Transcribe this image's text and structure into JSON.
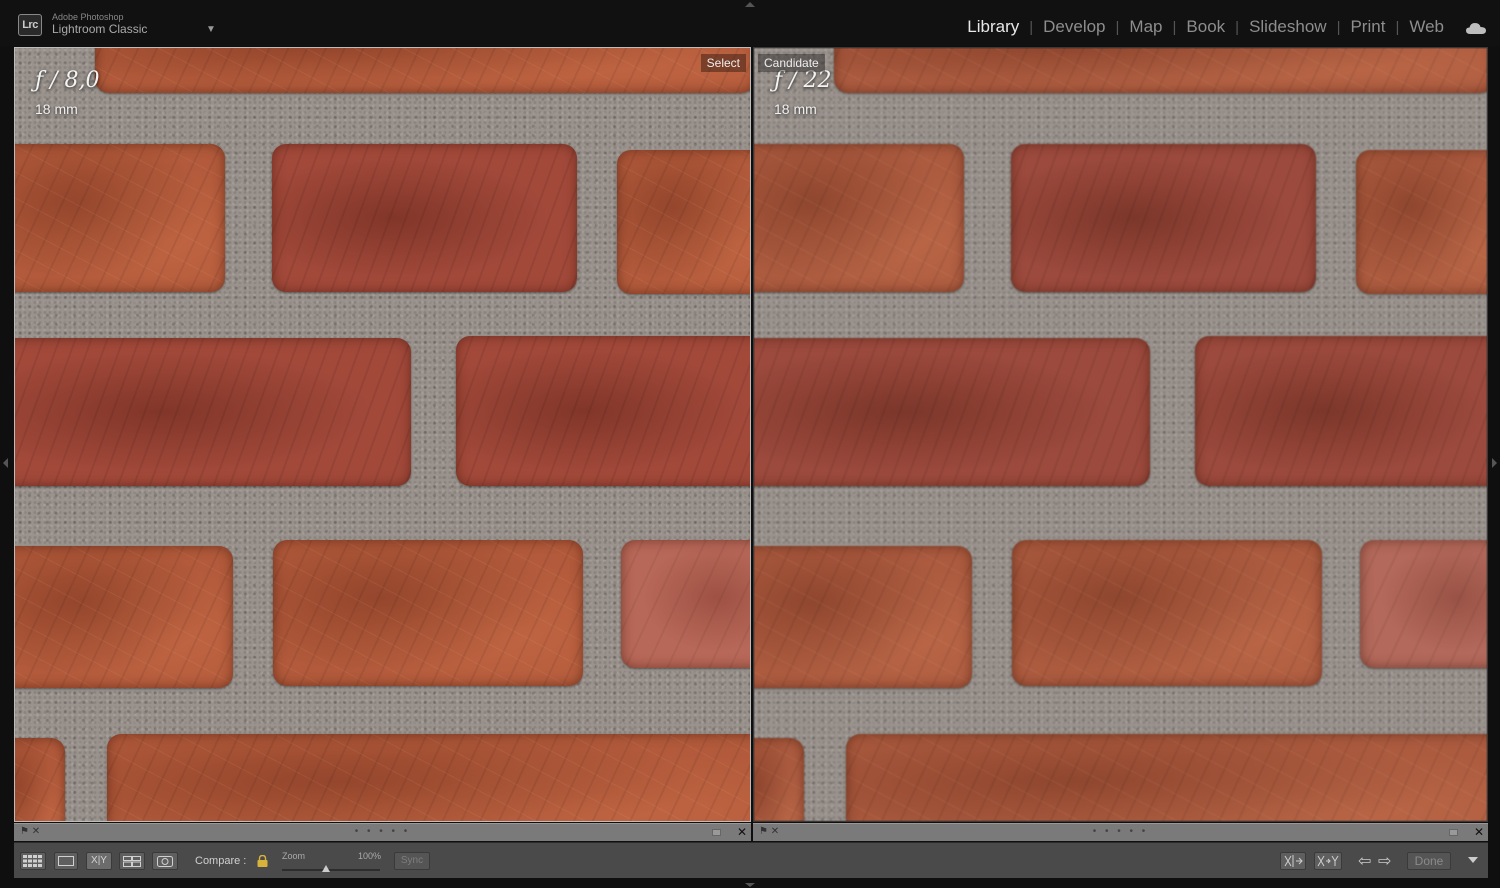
{
  "app": {
    "logo_text": "Lrc",
    "brand_top": "Adobe Photoshop",
    "brand_main": "Lightroom Classic",
    "menu_caret": "▼"
  },
  "modules": [
    {
      "label": "Library",
      "active": true
    },
    {
      "label": "Develop",
      "active": false
    },
    {
      "label": "Map",
      "active": false
    },
    {
      "label": "Book",
      "active": false
    },
    {
      "label": "Slideshow",
      "active": false
    },
    {
      "label": "Print",
      "active": false
    },
    {
      "label": "Web",
      "active": false
    }
  ],
  "module_separator": "|",
  "panes": {
    "select": {
      "label": "Select",
      "aperture": "ƒ / 8,0",
      "focal": "18 mm"
    },
    "candidate": {
      "label": "Candidate",
      "aperture": "ƒ / 22",
      "focal": "18 mm"
    }
  },
  "strip": {
    "rating_dots": "• • • • •",
    "close_glyph": "✕",
    "flag_glyphs": "⚑ ✕"
  },
  "toolbar": {
    "compare_label": "Compare :",
    "zoom_label": "Zoom",
    "zoom_percent": "100%",
    "zoom_level": 0.45,
    "sync_label": "Sync",
    "done_label": "Done",
    "xy_label": "X|Y",
    "prev_glyph": "⇦",
    "next_glyph": "⇨"
  },
  "colors": {
    "accent_active": "#e8e8e8",
    "module_inactive": "#8d8d8d",
    "brick": "#b25a3b",
    "mortar": "#9a928c"
  }
}
